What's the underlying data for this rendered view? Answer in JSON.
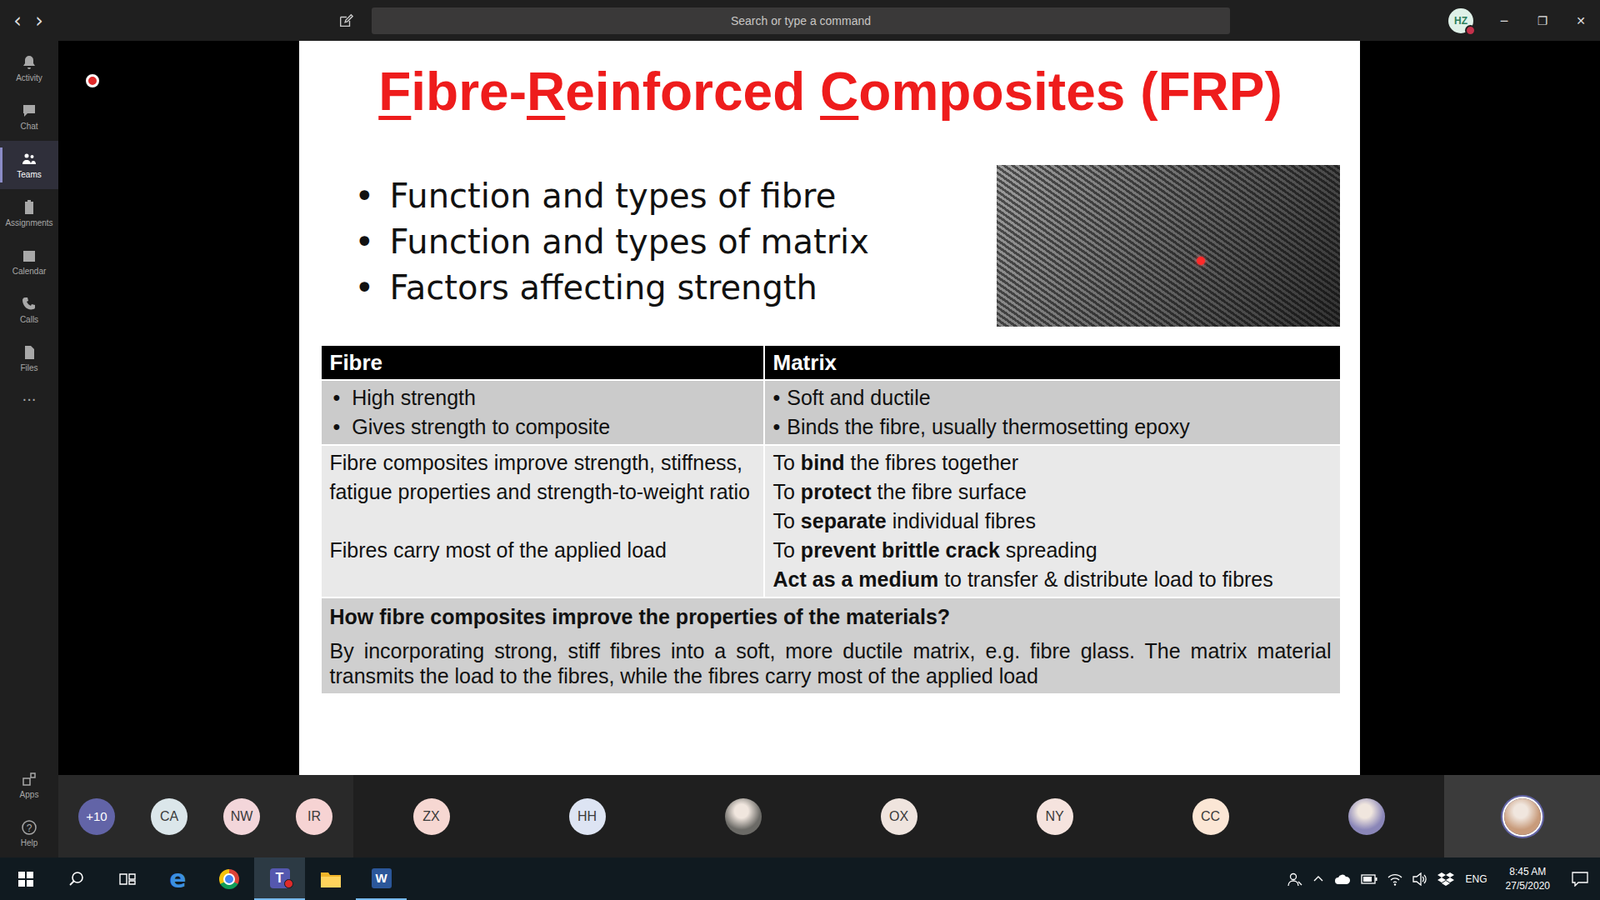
{
  "topbar": {
    "back": "‹",
    "forward": "›",
    "search": {
      "placeholder": "Search or type a command"
    },
    "user": {
      "initials": "HZ",
      "busy": true
    },
    "window_controls": [
      "─",
      "❐",
      "✕"
    ]
  },
  "rail": {
    "items": [
      {
        "label": "Activity",
        "selected": false
      },
      {
        "label": "Chat",
        "selected": false
      },
      {
        "label": "Teams",
        "selected": true
      },
      {
        "label": "Assignments",
        "selected": false
      },
      {
        "label": "Calendar",
        "selected": false
      },
      {
        "label": "Calls",
        "selected": false
      },
      {
        "label": "Files",
        "selected": false
      }
    ],
    "more": "···",
    "bottom": [
      {
        "label": "Apps",
        "selected": false
      },
      {
        "label": "Help",
        "glyph": "?",
        "selected": false
      }
    ]
  },
  "meeting": {
    "recording": true
  },
  "slide": {
    "title": [
      {
        "text": "F",
        "underlined": true
      },
      {
        "text": "ibre-",
        "underlined": false
      },
      {
        "text": "R",
        "underlined": true
      },
      {
        "text": "einforced ",
        "underlined": false
      },
      {
        "text": "C",
        "underlined": true
      },
      {
        "text": "omposites (FRP)",
        "underlined": false
      }
    ],
    "marker": "•",
    "bullets": [
      "Function and types of fibre",
      "Function and types of matrix",
      "Factors affecting strength"
    ],
    "table": {
      "headers": [
        "Fibre",
        "Matrix"
      ],
      "summary": {
        "fibre": [
          "High strength",
          "Gives strength to composite"
        ],
        "matrix": [
          "Soft and ductile",
          "Binds the fibre, usually thermosetting epoxy"
        ]
      },
      "details": {
        "fibre": [
          "Fibre composites improve strength, stiffness, fatigue properties and strength-to-weight ratio",
          "Fibres carry most of the applied load"
        ],
        "matrix": [
          [
            {
              "text": "To ",
              "bold": false
            },
            {
              "text": "bind",
              "bold": true
            },
            {
              "text": " the fibres together",
              "bold": false
            }
          ],
          [
            {
              "text": "To ",
              "bold": false
            },
            {
              "text": "protect",
              "bold": true
            },
            {
              "text": " the fibre surface",
              "bold": false
            }
          ],
          [
            {
              "text": "To ",
              "bold": false
            },
            {
              "text": "separate",
              "bold": true
            },
            {
              "text": " individual fibres",
              "bold": false
            }
          ],
          [
            {
              "text": "To ",
              "bold": false
            },
            {
              "text": "prevent brittle crack",
              "bold": true
            },
            {
              "text": " spreading",
              "bold": false
            }
          ],
          [
            {
              "text": "Act as a medium",
              "bold": true
            },
            {
              "text": " to transfer & distribute load to fibres",
              "bold": false
            }
          ]
        ]
      },
      "question": "How fibre composites improve the properties of the materials?",
      "answer": "By incorporating strong, stiff fibres into a soft, more ductile matrix, e.g. fibre glass. The matrix material transmits the load to the fibres, while the fibres carry most of the applied load"
    }
  },
  "participants": {
    "overflow": [
      {
        "kind": "count",
        "text": "+10",
        "color": "#6264a7"
      },
      {
        "kind": "initials",
        "text": "CA",
        "color": "#dbe6ea"
      },
      {
        "kind": "initials",
        "text": "NW",
        "color": "#f3d6da"
      },
      {
        "kind": "initials",
        "text": "IR",
        "color": "#f6d3d3"
      }
    ],
    "tiles": [
      {
        "kind": "initials",
        "text": "ZX",
        "color": "#f6d7d2",
        "selected": false
      },
      {
        "kind": "initials",
        "text": "HH",
        "color": "#dde4f3",
        "selected": false
      },
      {
        "kind": "photo",
        "color": "#6b6a66",
        "selected": false
      },
      {
        "kind": "initials",
        "text": "OX",
        "color": "#efe4de",
        "selected": false
      },
      {
        "kind": "initials",
        "text": "NY",
        "color": "#f5e3de",
        "selected": false
      },
      {
        "kind": "initials",
        "text": "CC",
        "color": "#fbe6d5",
        "selected": false
      },
      {
        "kind": "photo",
        "color": "#8a86b8",
        "selected": false
      },
      {
        "kind": "photo",
        "color": "#c89b7b",
        "selected": true
      }
    ]
  },
  "taskbar": {
    "apps": [
      {
        "kind": "edge",
        "glyph": "e",
        "open": false,
        "active": false,
        "badge": false
      },
      {
        "kind": "chrome",
        "open": false,
        "active": false,
        "badge": false
      },
      {
        "kind": "teams",
        "glyph": "T",
        "open": true,
        "active": true,
        "badge": true
      },
      {
        "kind": "explorer",
        "open": false,
        "active": false,
        "badge": false
      },
      {
        "kind": "word",
        "glyph": "W",
        "open": true,
        "active": false,
        "badge": false
      }
    ],
    "language": "ENG",
    "time": "8:45 AM",
    "date": "27/5/2020"
  }
}
